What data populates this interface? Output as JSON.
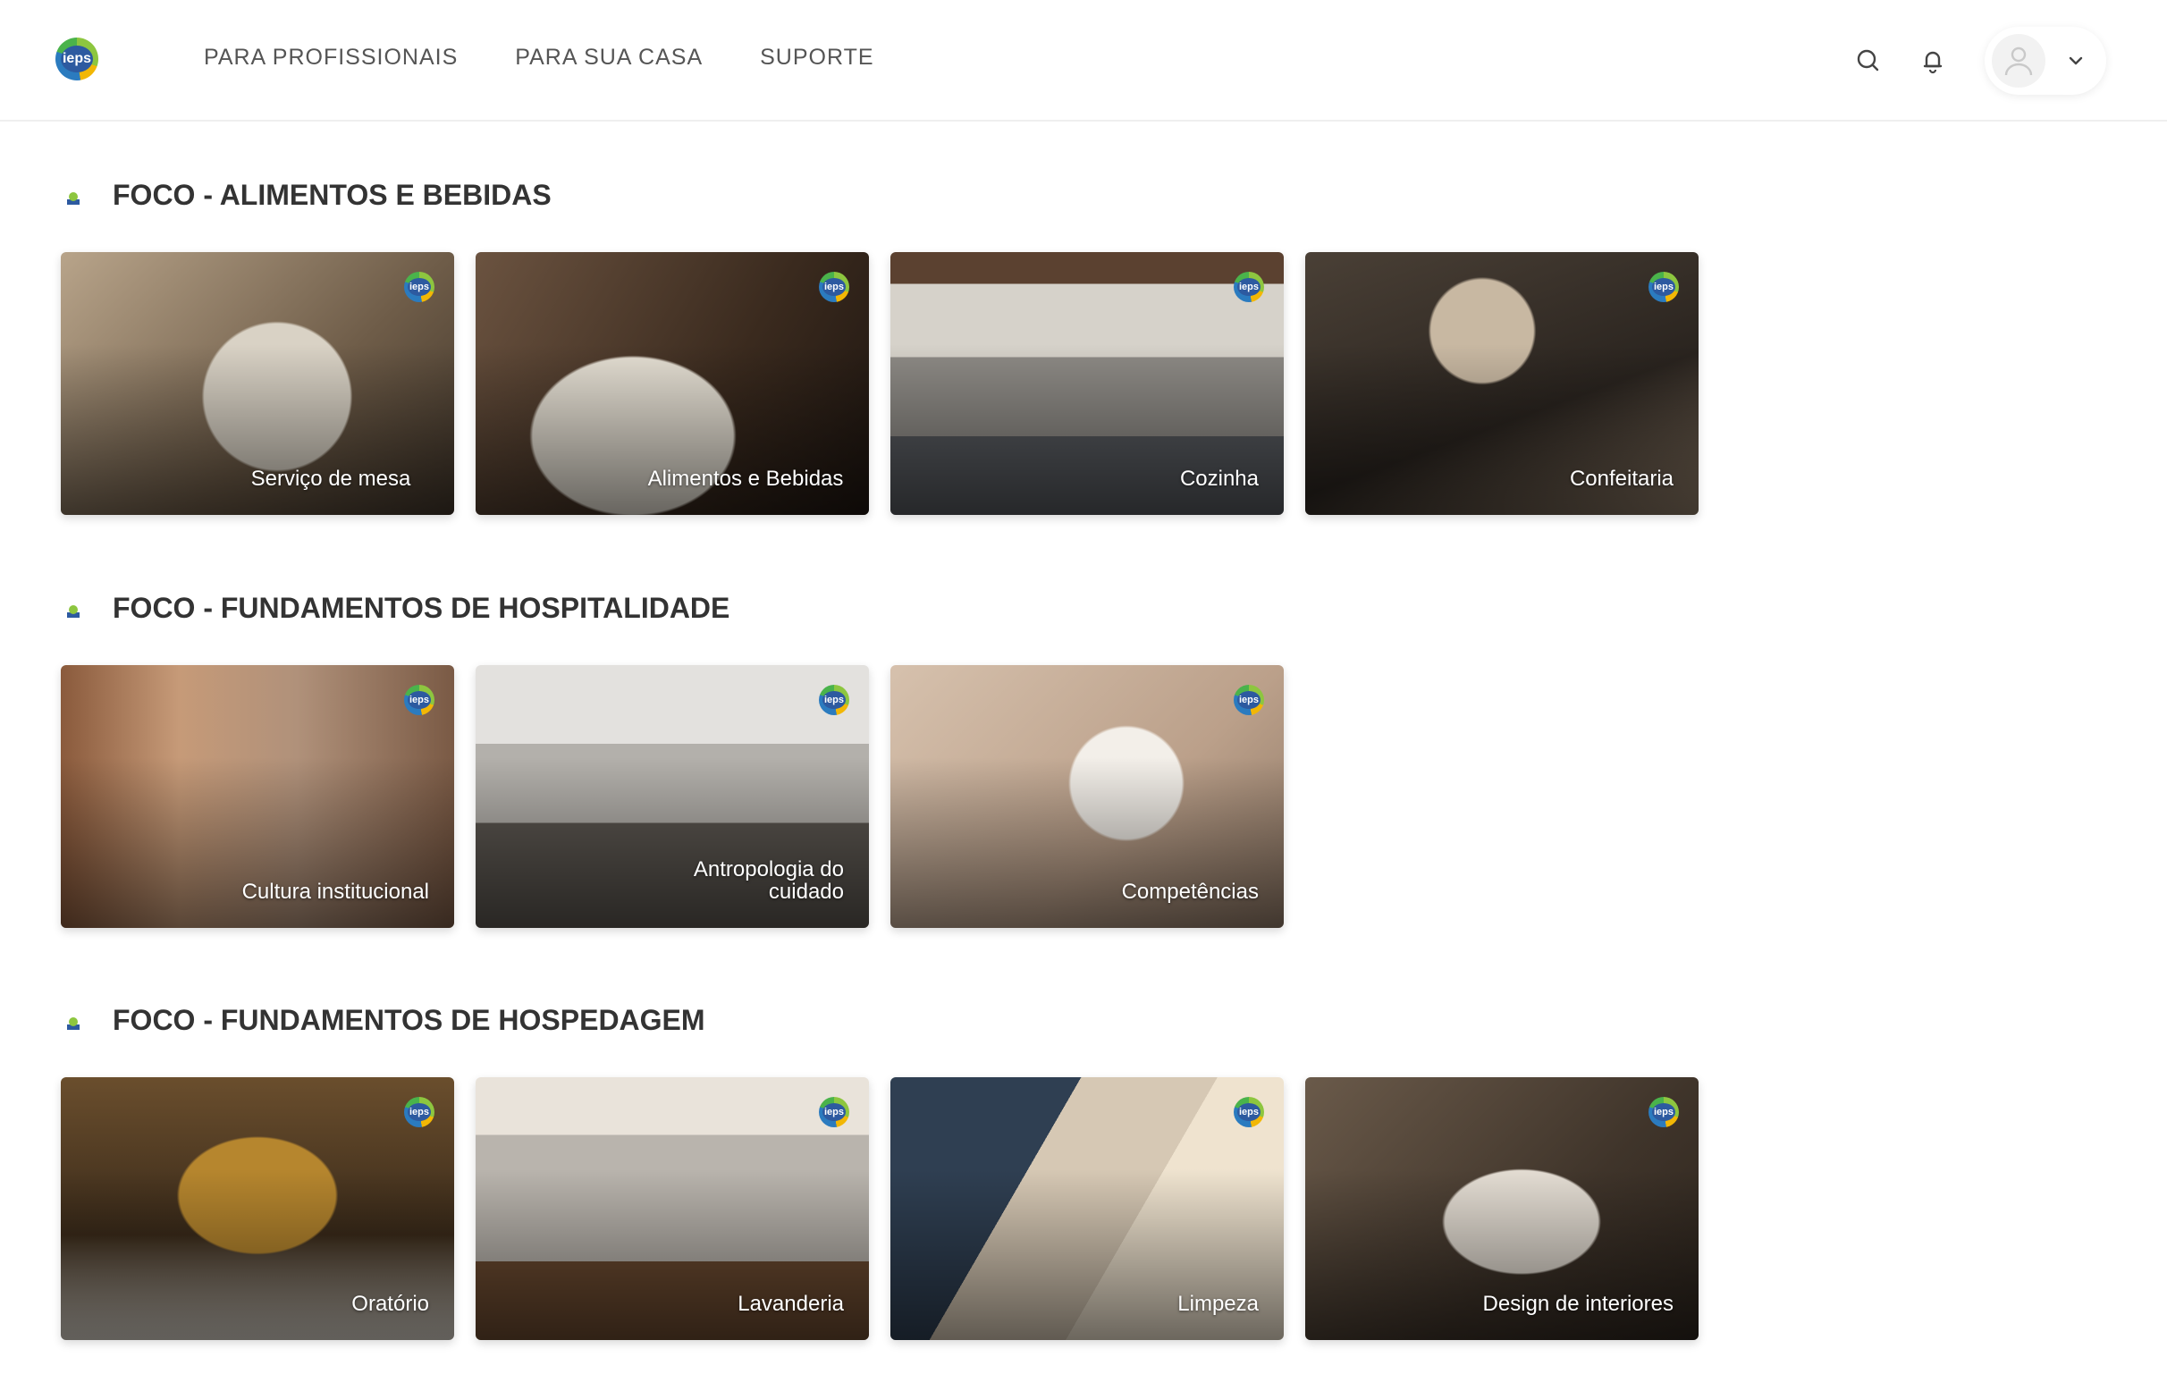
{
  "header": {
    "logo_text": "ieps",
    "nav": [
      "PARA PROFISSIONAIS",
      "PARA SUA CASA",
      "SUPORTE"
    ],
    "icons": [
      "search-icon",
      "bell-icon",
      "user-icon",
      "chevron-down-icon"
    ]
  },
  "badge_text": "ieps",
  "sections": [
    {
      "title": "FOCO - ALIMENTOS E BEBIDAS",
      "cards": [
        {
          "label": "Serviço de mesa"
        },
        {
          "label": "Alimentos e Bebidas"
        },
        {
          "label": "Cozinha"
        },
        {
          "label": "Confeitaria"
        }
      ]
    },
    {
      "title": "FOCO - FUNDAMENTOS DE HOSPITALIDADE",
      "cards": [
        {
          "label": "Cultura institucional"
        },
        {
          "label": "Antropologia do cuidado"
        },
        {
          "label": "Competências"
        }
      ]
    },
    {
      "title": "FOCO - FUNDAMENTOS DE HOSPEDAGEM",
      "cards": [
        {
          "label": "Oratório"
        },
        {
          "label": "Lavanderia"
        },
        {
          "label": "Limpeza"
        },
        {
          "label": "Design de interiores"
        }
      ]
    }
  ],
  "colors": {
    "brand_blue": "#2d5aa0",
    "brand_green": "#8dc63f",
    "brand_yellow": "#f2b705"
  }
}
